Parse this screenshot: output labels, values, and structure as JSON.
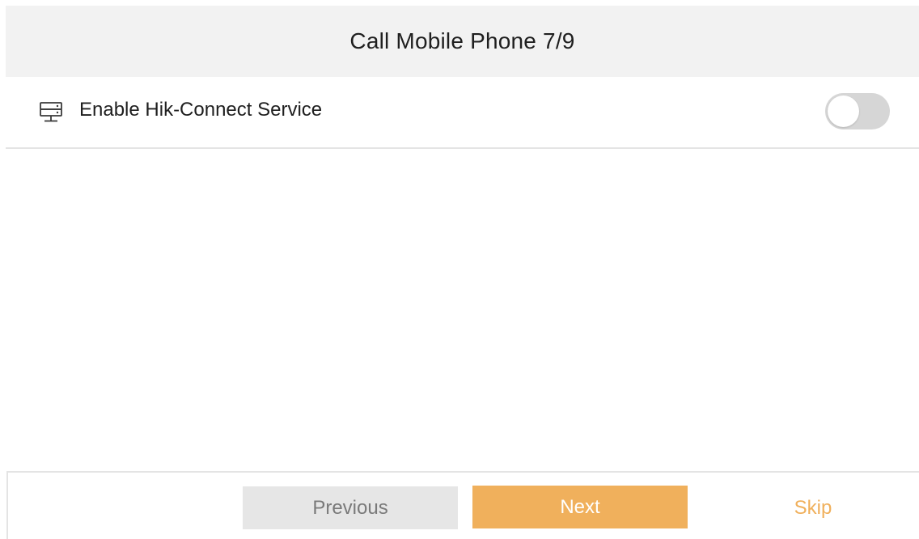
{
  "header": {
    "title": "Call Mobile Phone 7/9"
  },
  "settings": {
    "hik_connect": {
      "icon": "server-icon",
      "label": "Enable Hik-Connect Service",
      "enabled": false
    }
  },
  "footer": {
    "previous_label": "Previous",
    "next_label": "Next",
    "skip_label": "Skip"
  },
  "colors": {
    "accent": "#f0b05c",
    "header_bg": "#f2f2f2",
    "toggle_off": "#d6d6d6",
    "previous_bg": "#e6e6e6",
    "previous_text": "#7a7a7a",
    "divider": "#e4e4e4"
  }
}
